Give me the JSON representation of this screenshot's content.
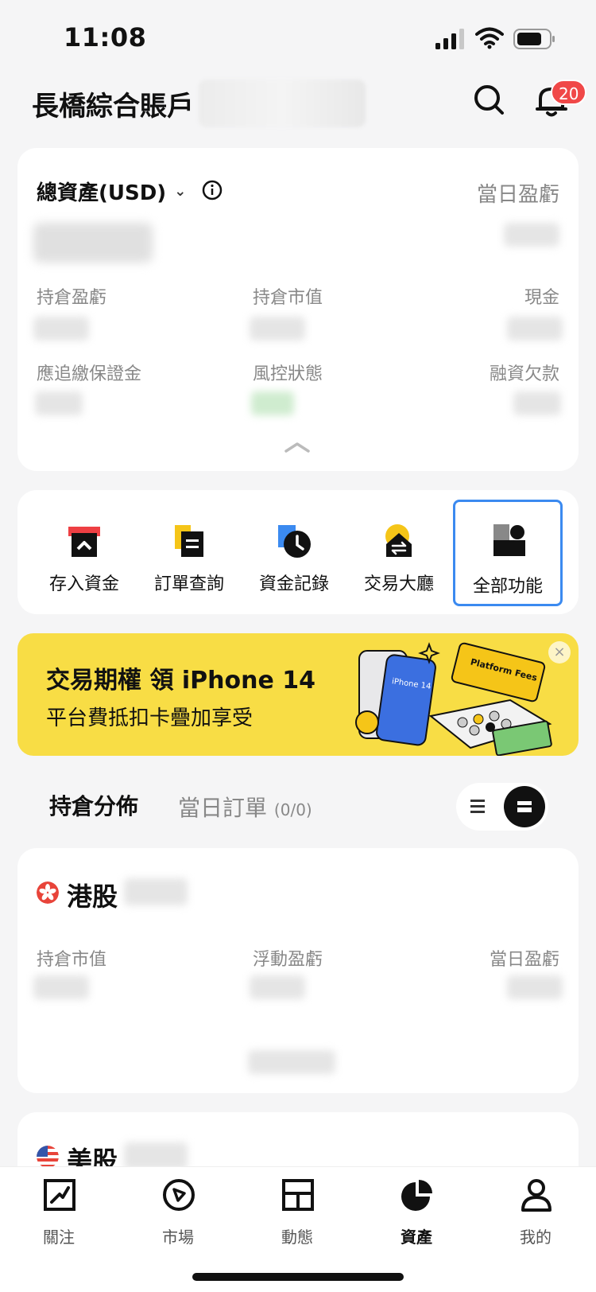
{
  "status_bar": {
    "time": "11:08"
  },
  "header": {
    "account_title": "長橋綜合賬戶",
    "notification_count": "20"
  },
  "assets": {
    "total_label": "總資產(USD)",
    "daily_pl_label": "當日盈虧",
    "metrics": [
      {
        "label": "持倉盈虧"
      },
      {
        "label": "持倉市值"
      },
      {
        "label": "現金"
      },
      {
        "label": "應追繳保證金"
      },
      {
        "label": "風控狀態"
      },
      {
        "label": "融資欠款"
      }
    ]
  },
  "actions": [
    {
      "label": "存入資金",
      "icon": "deposit-icon"
    },
    {
      "label": "訂單查詢",
      "icon": "order-query-icon"
    },
    {
      "label": "資金記錄",
      "icon": "fund-record-icon"
    },
    {
      "label": "交易大廳",
      "icon": "trading-hall-icon"
    },
    {
      "label": "全部功能",
      "icon": "all-functions-icon"
    }
  ],
  "banner": {
    "title": "交易期權 領 iPhone 14",
    "subtitle": "平台費抵扣卡疊加享受",
    "close": "×",
    "art_phone_text": "iPhone 14",
    "art_card_text": "Platform Fees"
  },
  "tabs": {
    "holdings": "持倉分佈",
    "orders": "當日訂單",
    "orders_count": "(0/0)"
  },
  "hk_market": {
    "title": "港股",
    "labels": [
      "持倉市值",
      "浮動盈虧",
      "當日盈虧"
    ]
  },
  "us_market": {
    "title": "美股"
  },
  "tabbar": [
    {
      "label": "關注",
      "icon": "watchlist-icon"
    },
    {
      "label": "市場",
      "icon": "market-compass-icon"
    },
    {
      "label": "動態",
      "icon": "feed-icon"
    },
    {
      "label": "資產",
      "icon": "assets-pie-icon",
      "active": true
    },
    {
      "label": "我的",
      "icon": "profile-icon"
    }
  ],
  "colors": {
    "accent_blue": "#3b8af0",
    "banner_yellow": "#f8dd45",
    "badge_red": "#f04848",
    "background": "#f5f5f6"
  }
}
